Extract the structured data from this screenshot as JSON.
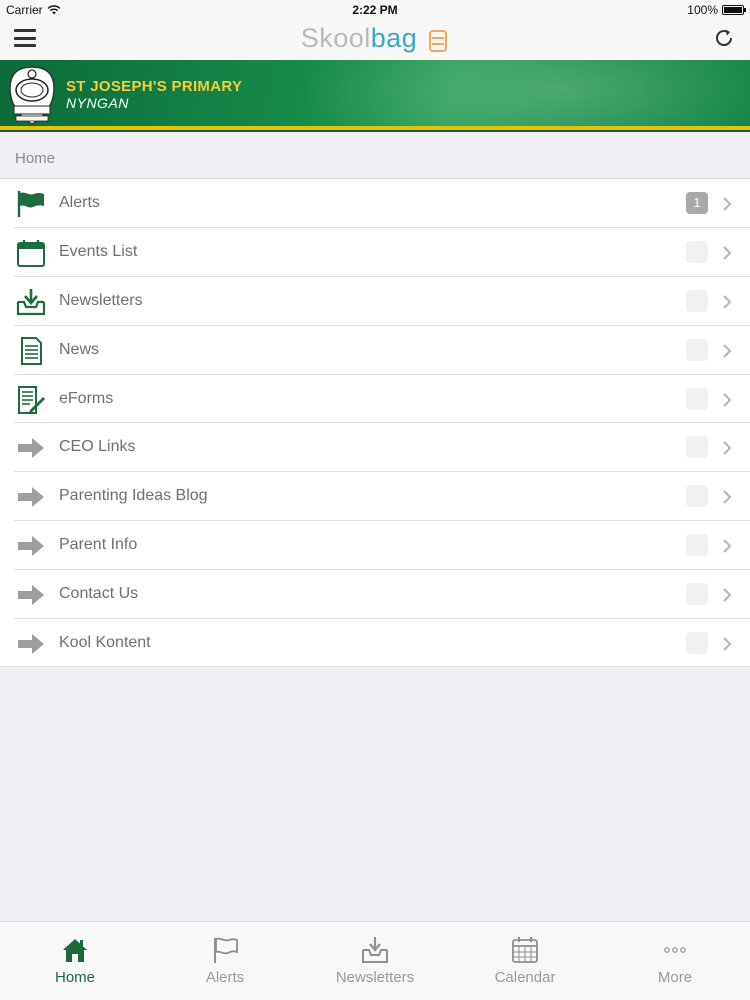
{
  "status_bar": {
    "carrier": "Carrier",
    "time": "2:22 PM",
    "battery": "100%"
  },
  "nav": {
    "logo_part1": "Skool",
    "logo_part2": "bag"
  },
  "banner": {
    "school_name": "ST JOSEPH'S PRIMARY",
    "school_town": "NYNGAN"
  },
  "breadcrumb": "Home",
  "menu": {
    "items": [
      {
        "label": "Alerts",
        "icon": "flag-icon",
        "badge": "1",
        "badge_active": true
      },
      {
        "label": "Events List",
        "icon": "calendar-icon",
        "badge": "0",
        "badge_active": false
      },
      {
        "label": "Newsletters",
        "icon": "inbox-download-icon",
        "badge": "0",
        "badge_active": false
      },
      {
        "label": "News",
        "icon": "document-icon",
        "badge": "0",
        "badge_active": false
      },
      {
        "label": "eForms",
        "icon": "form-pen-icon",
        "badge": "0",
        "badge_active": false
      },
      {
        "label": "CEO Links",
        "icon": "arrow-right-icon",
        "badge": "0",
        "badge_active": false
      },
      {
        "label": "Parenting Ideas Blog",
        "icon": "arrow-right-icon",
        "badge": "0",
        "badge_active": false
      },
      {
        "label": "Parent Info",
        "icon": "arrow-right-icon",
        "badge": "0",
        "badge_active": false
      },
      {
        "label": "Contact Us",
        "icon": "arrow-right-icon",
        "badge": "0",
        "badge_active": false
      },
      {
        "label": "Kool Kontent",
        "icon": "arrow-right-icon",
        "badge": "0",
        "badge_active": false
      }
    ]
  },
  "tabs": [
    {
      "label": "Home",
      "icon": "home-icon",
      "active": true
    },
    {
      "label": "Alerts",
      "icon": "flag-icon",
      "active": false
    },
    {
      "label": "Newsletters",
      "icon": "inbox-download-icon",
      "active": false
    },
    {
      "label": "Calendar",
      "icon": "calendar-grid-icon",
      "active": false
    },
    {
      "label": "More",
      "icon": "more-dots-icon",
      "active": false
    }
  ],
  "colors": {
    "brand_green": "#1a6a3c",
    "icon_green": "#1e6b40",
    "banner_yellow": "#e8c200",
    "logo_blue": "#3aa8c3"
  }
}
